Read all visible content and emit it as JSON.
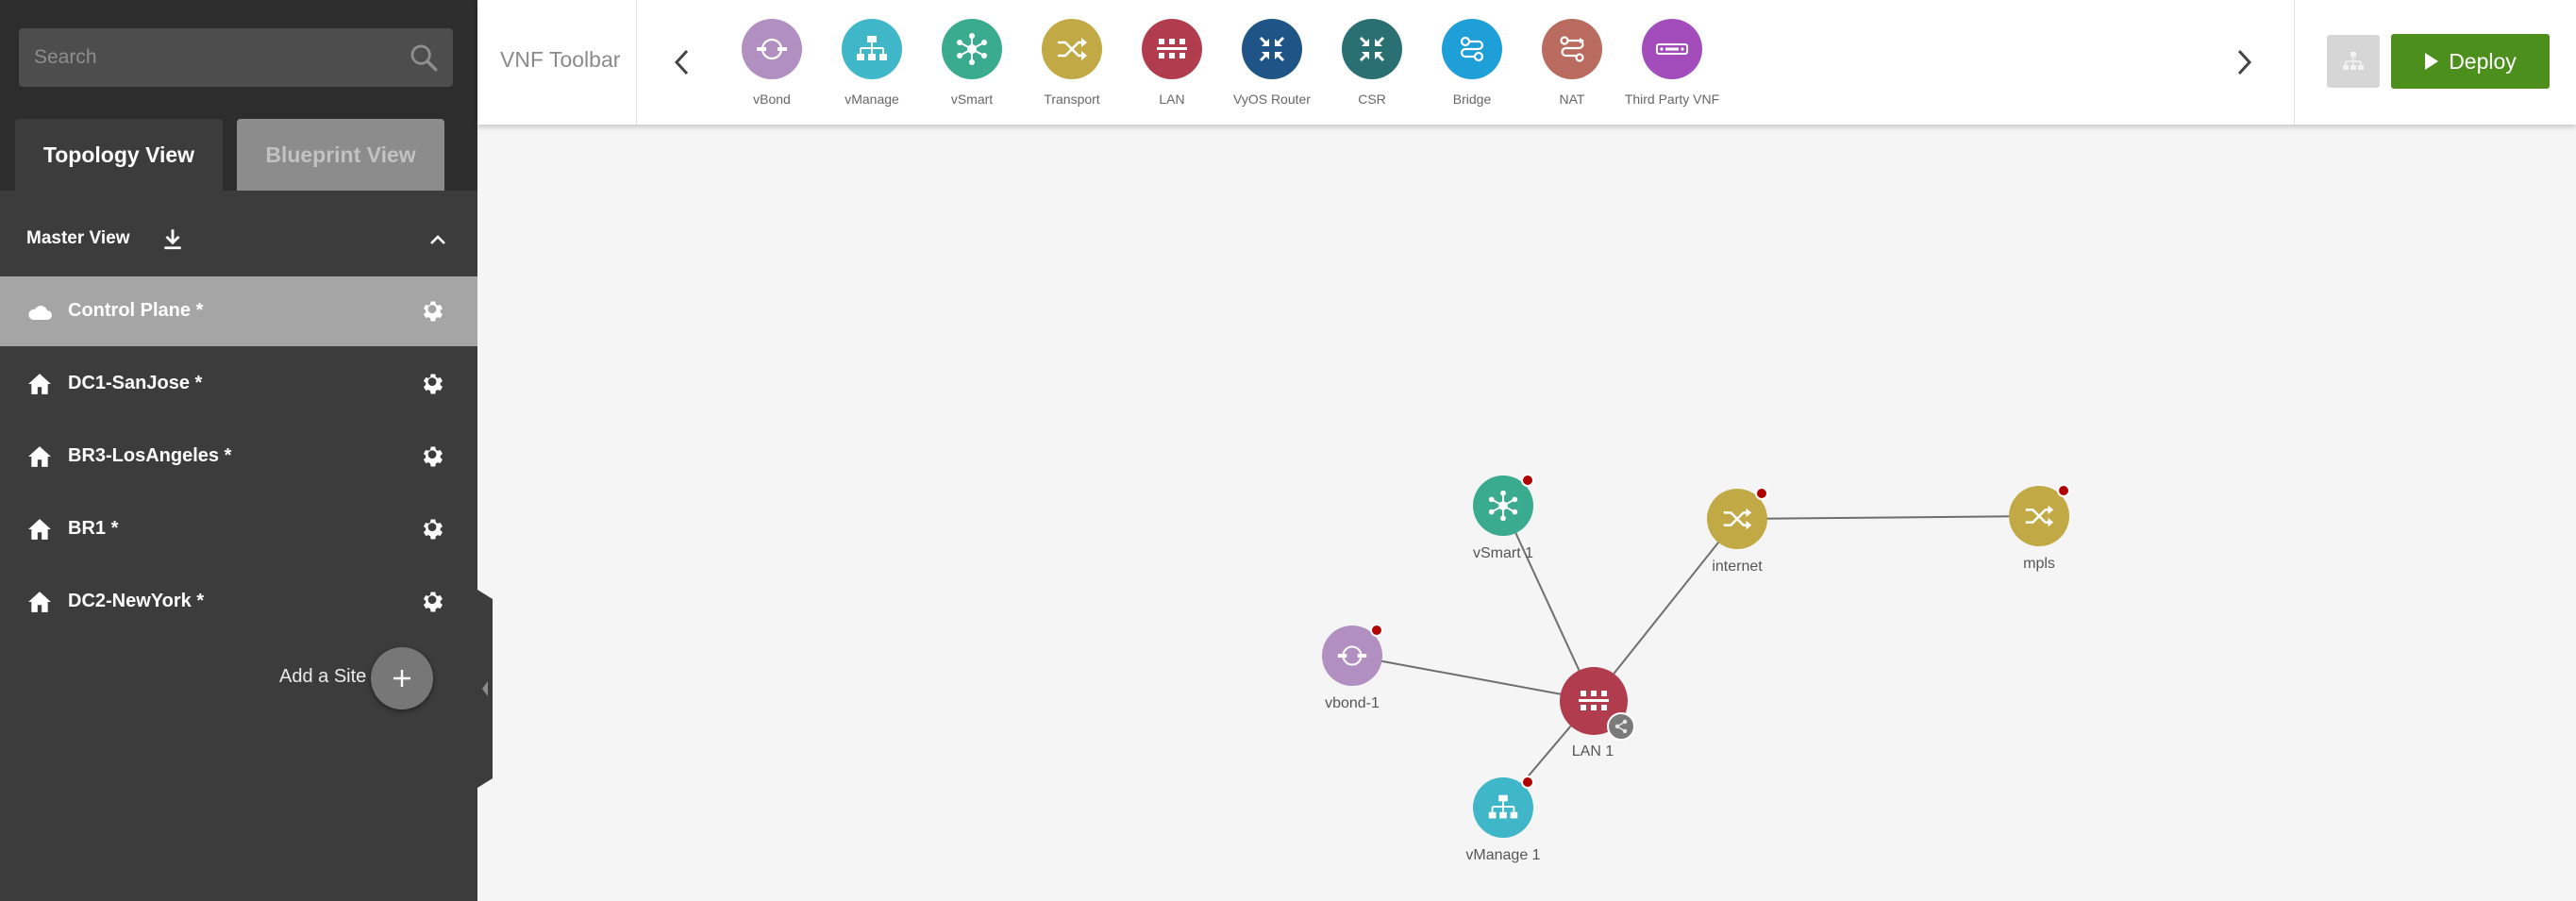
{
  "sidebar": {
    "search": {
      "placeholder": "Search",
      "value": ""
    },
    "tabs": {
      "topology": "Topology View",
      "blueprint": "Blueprint View"
    },
    "master_view": "Master View",
    "sites": [
      {
        "label": "Control Plane *",
        "icon": "cloud-icon",
        "active": true
      },
      {
        "label": "DC1-SanJose *",
        "icon": "home-icon",
        "active": false
      },
      {
        "label": "BR3-LosAngeles *",
        "icon": "home-icon",
        "active": false
      },
      {
        "label": "BR1 *",
        "icon": "home-icon",
        "active": false
      },
      {
        "label": "DC2-NewYork *",
        "icon": "home-icon",
        "active": false
      }
    ],
    "add_site_label": "Add a Site"
  },
  "toolbar": {
    "title": "VNF Toolbar",
    "tools": [
      {
        "label": "vBond",
        "icon": "vbond-icon",
        "color": "#b18fc1"
      },
      {
        "label": "vManage",
        "icon": "vmanage-icon",
        "color": "#3fb7c8"
      },
      {
        "label": "vSmart",
        "icon": "vsmart-icon",
        "color": "#3aab8e"
      },
      {
        "label": "Transport",
        "icon": "transport-icon",
        "color": "#c1aa45"
      },
      {
        "label": "LAN",
        "icon": "lan-icon",
        "color": "#b03c4e"
      },
      {
        "label": "VyOS Router",
        "icon": "vyos-router-icon",
        "color": "#1f5586"
      },
      {
        "label": "CSR",
        "icon": "csr-icon",
        "color": "#2a6f72"
      },
      {
        "label": "Bridge",
        "icon": "bridge-icon",
        "color": "#1f9fd8"
      },
      {
        "label": "NAT",
        "icon": "nat-icon",
        "color": "#b86b5e"
      },
      {
        "label": "Third Party VNF",
        "icon": "third-party-vnf-icon",
        "color": "#a24dbb"
      }
    ],
    "deploy_label": "Deploy"
  },
  "topology": {
    "nodes": [
      {
        "id": "vsmart1",
        "label": "vSmart 1",
        "type": "vsmart",
        "color": "#3aab8e",
        "status": "error"
      },
      {
        "id": "internet",
        "label": "internet",
        "type": "transport",
        "color": "#c1aa45",
        "status": "error"
      },
      {
        "id": "mpls",
        "label": "mpls",
        "type": "transport",
        "color": "#c1aa45",
        "status": "error"
      },
      {
        "id": "vbond1",
        "label": "vbond-1",
        "type": "vbond",
        "color": "#b18fc1",
        "status": "error"
      },
      {
        "id": "lan1",
        "label": "LAN 1",
        "type": "lan",
        "color": "#b03c4e",
        "status": "shared"
      },
      {
        "id": "vmanage1",
        "label": "vManage 1",
        "type": "vmanage",
        "color": "#3fb7c8",
        "status": "error"
      }
    ],
    "links": [
      [
        "lan1",
        "vsmart1"
      ],
      [
        "lan1",
        "internet"
      ],
      [
        "internet",
        "mpls"
      ],
      [
        "lan1",
        "vbond1"
      ],
      [
        "lan1",
        "vmanage1"
      ]
    ],
    "status_color": "#b00000"
  }
}
